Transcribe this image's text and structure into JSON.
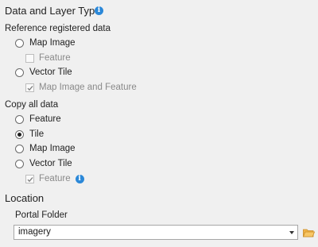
{
  "section1": {
    "title": "Data and Layer Type"
  },
  "reference": {
    "label": "Reference registered data",
    "options": [
      {
        "label": "Map Image",
        "checked": false
      },
      {
        "label": "Feature",
        "type": "checkbox",
        "checked": false,
        "disabled": true
      },
      {
        "label": "Vector Tile",
        "checked": false
      },
      {
        "label": "Map Image and Feature",
        "type": "checkbox",
        "checked": true,
        "disabled": true
      }
    ]
  },
  "copy": {
    "label": "Copy all data",
    "options": [
      {
        "label": "Feature",
        "checked": false
      },
      {
        "label": "Tile",
        "checked": true
      },
      {
        "label": "Map Image",
        "checked": false
      },
      {
        "label": "Vector Tile",
        "checked": false
      },
      {
        "label": "Feature",
        "type": "checkbox",
        "checked": true,
        "disabled": true
      }
    ]
  },
  "location": {
    "title": "Location",
    "portal_label": "Portal Folder",
    "portal_value": "imagery"
  },
  "colors": {
    "info": "#2b88d8",
    "folder": "#e8a33d"
  },
  "icons": [
    "info-icon",
    "chevron-down-icon",
    "folder-icon"
  ]
}
